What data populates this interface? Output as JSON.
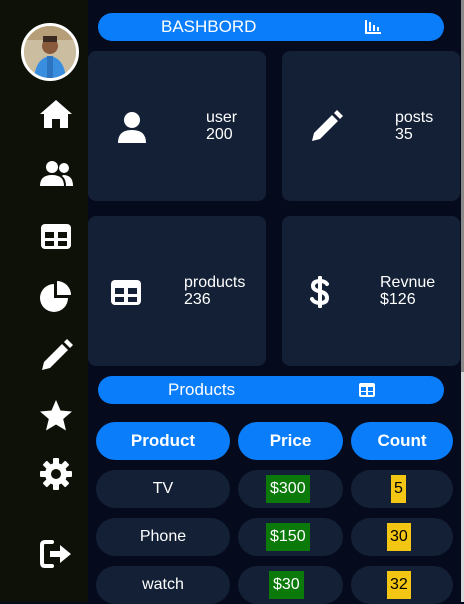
{
  "sidebar": {
    "avatar_alt": "user avatar",
    "items": [
      {
        "icon": "home-icon"
      },
      {
        "icon": "users-icon"
      },
      {
        "icon": "table-icon"
      },
      {
        "icon": "chart-pie-icon"
      },
      {
        "icon": "pencil-icon"
      },
      {
        "icon": "star-icon"
      },
      {
        "icon": "gear-icon"
      },
      {
        "icon": "sign-out-icon"
      }
    ]
  },
  "header": {
    "title": "BASHBORD",
    "icon": "chart-bar-icon"
  },
  "cards": [
    {
      "label": "user",
      "value": "200",
      "icon": "user-icon"
    },
    {
      "label": "posts",
      "value": "35",
      "icon": "pencil-icon"
    },
    {
      "label": "products",
      "value": "236",
      "icon": "table-icon"
    },
    {
      "label": "Revnue",
      "value": "$126",
      "icon": "dollar-icon"
    }
  ],
  "products_section": {
    "title": "Products",
    "icon": "table-icon"
  },
  "table": {
    "headers": [
      "Product",
      "Price",
      "Count"
    ],
    "rows": [
      {
        "product": "TV",
        "price": "$300",
        "count": "5"
      },
      {
        "product": "Phone",
        "price": "$150",
        "count": "30"
      },
      {
        "product": "watch",
        "price": "$30",
        "count": "32"
      }
    ]
  },
  "colors": {
    "accent": "#0a7dfb",
    "card_bg": "#132036",
    "page_bg": "#050a1c",
    "sidebar_bg": "#0e1108",
    "price_badge": "#0b7a0b",
    "count_badge": "#f3c613"
  }
}
